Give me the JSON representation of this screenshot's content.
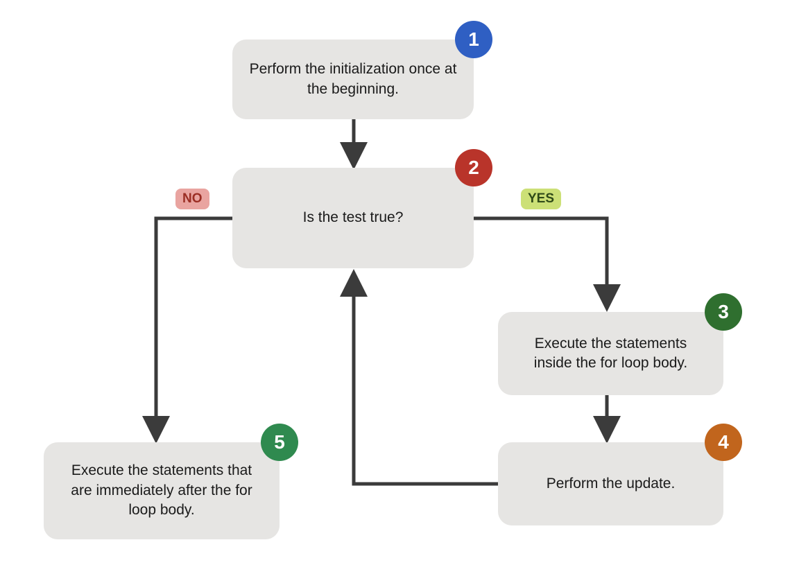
{
  "nodes": {
    "n1": {
      "num": "1",
      "text": "Perform the initialization once at the beginning.",
      "badgeColor": "#2f5fc3"
    },
    "n2": {
      "num": "2",
      "text": "Is the test true?",
      "badgeColor": "#b9342a"
    },
    "n3": {
      "num": "3",
      "text": "Execute the statements inside the for loop body.",
      "badgeColor": "#2f6f2f"
    },
    "n4": {
      "num": "4",
      "text": "Perform the update.",
      "badgeColor": "#c1651d"
    },
    "n5": {
      "num": "5",
      "text": "Execute the statements that are immediately after the for loop body.",
      "badgeColor": "#2f8a4f"
    }
  },
  "labels": {
    "no": "NO",
    "yes": "YES"
  }
}
